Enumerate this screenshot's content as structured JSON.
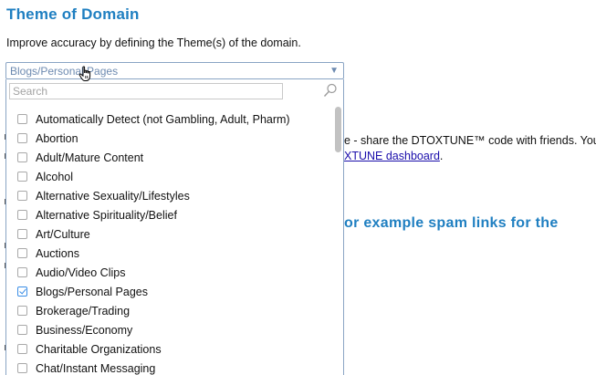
{
  "heading": "Theme of Domain",
  "subtext": "Improve accuracy by defining the Theme(s) of the domain.",
  "select": {
    "value": "Blogs/Personal Pages",
    "arrow": "▼"
  },
  "dropdown": {
    "search_placeholder": "Search",
    "options": [
      {
        "label": "Automatically Detect (not Gambling, Adult, Pharm)",
        "checked": false
      },
      {
        "label": "Abortion",
        "checked": false
      },
      {
        "label": "Adult/Mature Content",
        "checked": false
      },
      {
        "label": "Alcohol",
        "checked": false
      },
      {
        "label": "Alternative Sexuality/Lifestyles",
        "checked": false
      },
      {
        "label": "Alternative Spirituality/Belief",
        "checked": false
      },
      {
        "label": "Art/Culture",
        "checked": false
      },
      {
        "label": "Auctions",
        "checked": false
      },
      {
        "label": "Audio/Video Clips",
        "checked": false
      },
      {
        "label": "Blogs/Personal Pages",
        "checked": true
      },
      {
        "label": "Brokerage/Trading",
        "checked": false
      },
      {
        "label": "Business/Economy",
        "checked": false
      },
      {
        "label": "Charitable Organizations",
        "checked": false
      },
      {
        "label": "Chat/Instant Messaging",
        "checked": false
      }
    ]
  },
  "background": {
    "line1": "e - share the DTOXTUNE™ code with friends. You",
    "line2_link": "XTUNE dashboard",
    "line2_tail": ".",
    "heading2": "or example spam links for the"
  },
  "colors": {
    "heading": "#1f7fc1",
    "select_border": "#8aa4c4",
    "checkbox_checked": "#3b8ee6"
  }
}
